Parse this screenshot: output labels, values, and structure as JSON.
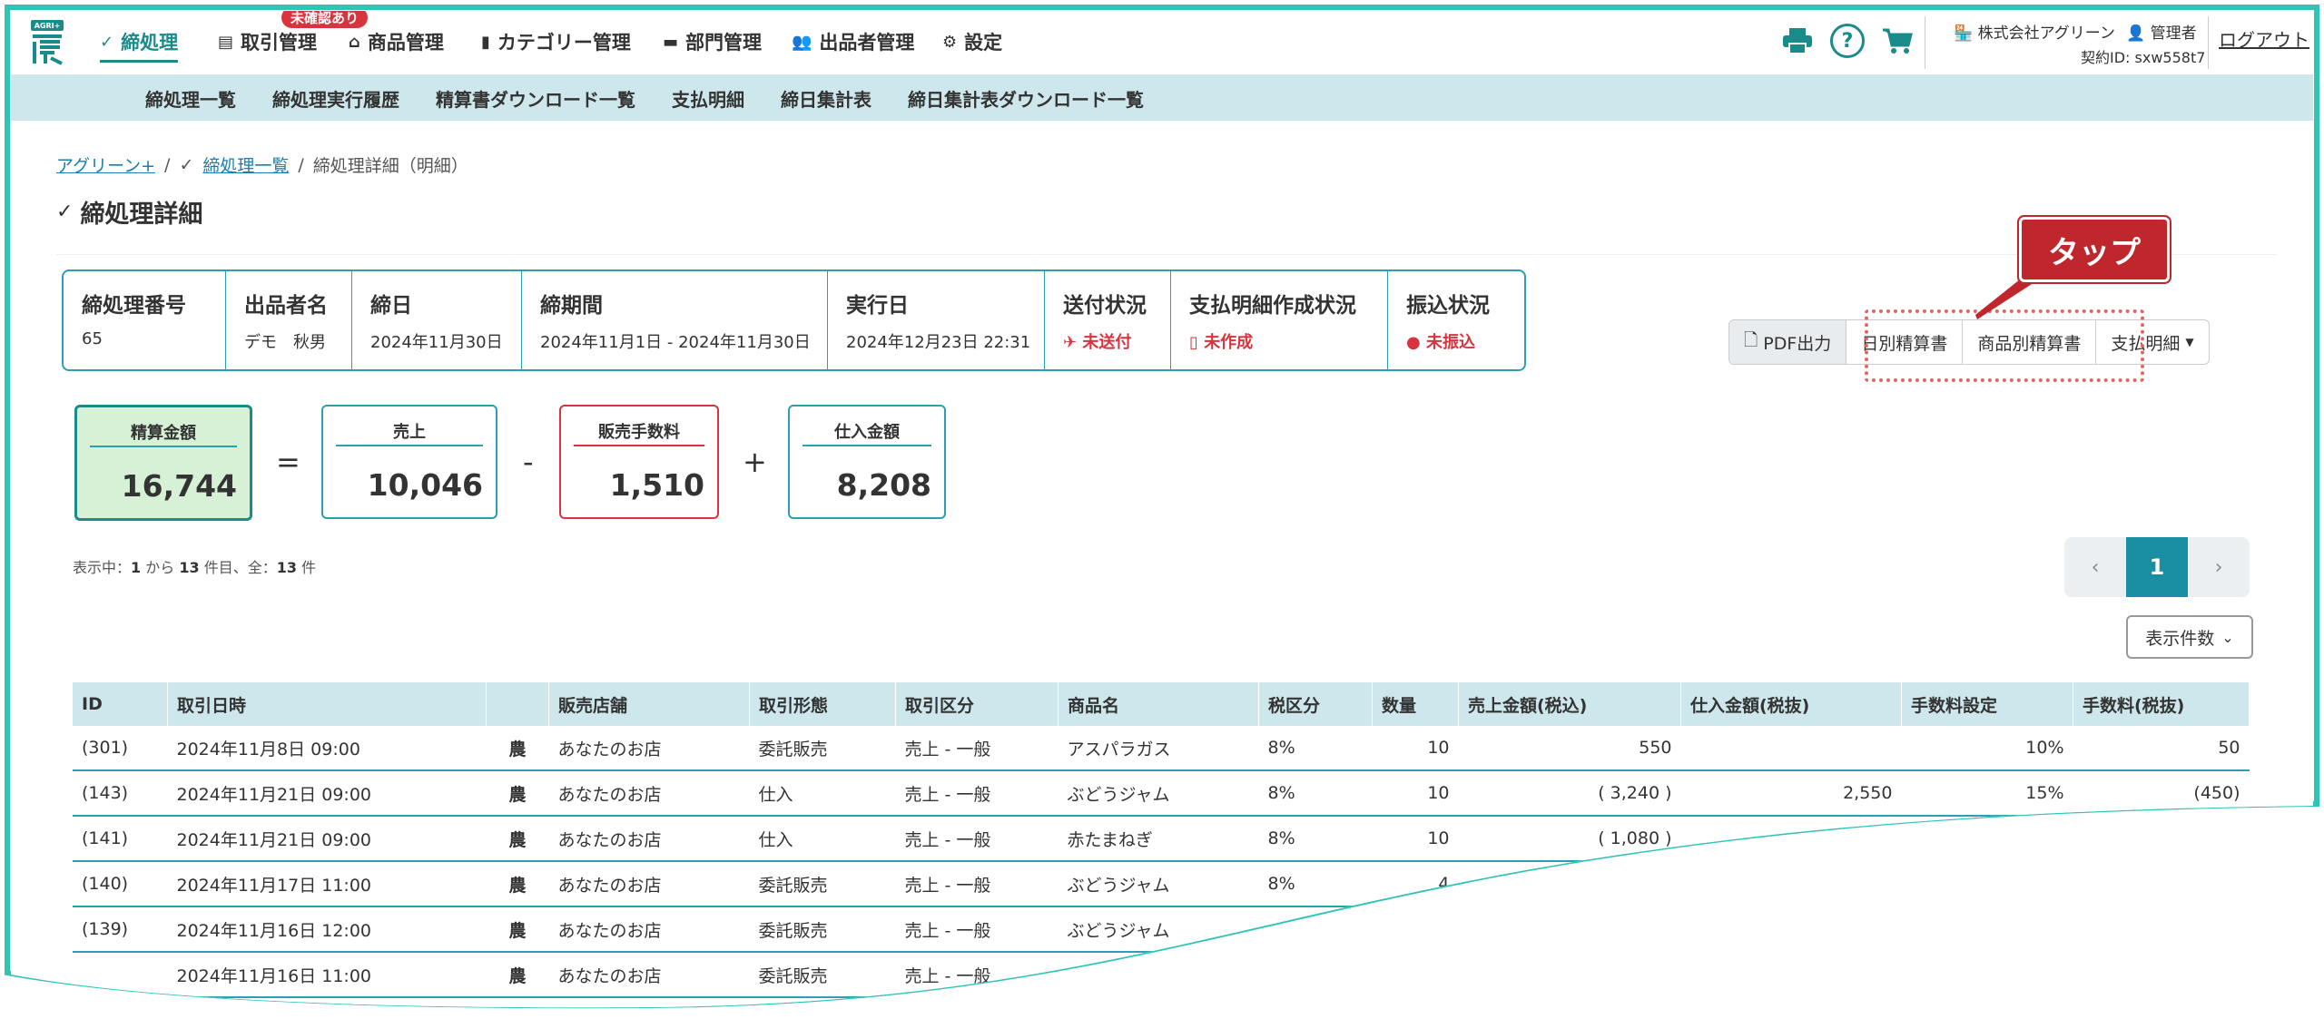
{
  "nav": {
    "logo_text": "AGRI+",
    "items": [
      {
        "label": "締処理",
        "icon": "check-circle-icon"
      },
      {
        "label": "取引管理",
        "icon": "receipt-icon"
      },
      {
        "label": "商品管理",
        "icon": "basket-icon"
      },
      {
        "label": "カテゴリー管理",
        "icon": "bookmark-icon"
      },
      {
        "label": "部門管理",
        "icon": "folder-icon"
      },
      {
        "label": "出品者管理",
        "icon": "users-icon"
      },
      {
        "label": "設定",
        "icon": "gear-icon"
      }
    ],
    "badge": "未確認あり",
    "company": "株式会社アグリーン",
    "role": "管理者",
    "contract": "契約ID: sxw558t7",
    "logout": "ログアウト"
  },
  "subnav": [
    "締処理一覧",
    "締処理実行履歴",
    "精算書ダウンロード一覧",
    "支払明細",
    "締日集計表",
    "締日集計表ダウンロード一覧"
  ],
  "breadcrumb": {
    "home": "アグリーン+",
    "list": "締処理一覧",
    "current": "締処理詳細（明細）",
    "sep": "/"
  },
  "page_title": "締処理詳細",
  "info": {
    "headers": [
      "締処理番号",
      "出品者名",
      "締日",
      "締期間",
      "実行日",
      "送付状況",
      "支払明細作成状況",
      "振込状況"
    ],
    "values": [
      "65",
      "デモ　秋男",
      "2024年11月30日",
      "2024年11月1日 - 2024年11月30日",
      "2024年12月23日 22:31",
      "未送付",
      "未作成",
      "未振込"
    ]
  },
  "summary": {
    "settle_label": "精算金額",
    "settle_value": "16,744",
    "sales_label": "売上",
    "sales_value": "10,046",
    "fee_label": "販売手数料",
    "fee_value": "1,510",
    "purchase_label": "仕入金額",
    "purchase_value": "8,208",
    "op_eq": "=",
    "op_minus": "-",
    "op_plus": "+"
  },
  "buttons": {
    "pdf": "PDF出力",
    "daily": "日別精算書",
    "product": "商品別精算書",
    "payment": "支払明細"
  },
  "callout": "タップ",
  "pagination": {
    "prev": "‹",
    "page": "1",
    "next": "›"
  },
  "count": {
    "prefix": "表示中：",
    "from": "1",
    "mid1": " から ",
    "to": "13",
    "mid2": " 件目、全：",
    "total": "13",
    "suffix": " 件"
  },
  "per_page": "表示件数",
  "table": {
    "headers": [
      "ID",
      "取引日時",
      "",
      "販売店舗",
      "取引形態",
      "取引区分",
      "商品名",
      "税区分",
      "数量",
      "売上金額(税込)",
      "仕入金額(税抜)",
      "手数料設定",
      "手数料(税抜)"
    ],
    "rows": [
      [
        "(301)",
        "2024年11月8日 09:00",
        "農",
        "あなたのお店",
        "委託販売",
        "売上 - 一般",
        "アスパラガス",
        "8%",
        "10",
        "550",
        "",
        "10%",
        "50"
      ],
      [
        "(143)",
        "2024年11月21日 09:00",
        "農",
        "あなたのお店",
        "仕入",
        "売上 - 一般",
        "ぶどうジャム",
        "8%",
        "10",
        "( 3,240 )",
        "2,550",
        "15%",
        "(450)"
      ],
      [
        "(141)",
        "2024年11月21日 09:00",
        "農",
        "あなたのお店",
        "仕入",
        "売上 - 一般",
        "赤たまねぎ",
        "8%",
        "10",
        "( 1,080 )",
        "",
        "",
        ""
      ],
      [
        "(140)",
        "2024年11月17日 11:00",
        "農",
        "あなたのお店",
        "委託販売",
        "売上 - 一般",
        "ぶどうジャム",
        "8%",
        "4",
        "",
        "",
        "",
        ""
      ],
      [
        "(139)",
        "2024年11月16日 12:00",
        "農",
        "あなたのお店",
        "委託販売",
        "売上 - 一般",
        "ぶどうジャム",
        "",
        "",
        "",
        "",
        "",
        ""
      ],
      [
        "",
        "2024年11月16日 11:00",
        "農",
        "あなたのお店",
        "委託販売",
        "売上 - 一般",
        "",
        "",
        "",
        "",
        "",
        "",
        ""
      ]
    ]
  },
  "colors": {
    "accent": "#1a8b8b",
    "header_bg": "#cde7ec",
    "danger": "#d8343f",
    "callout": "#c0272d"
  }
}
